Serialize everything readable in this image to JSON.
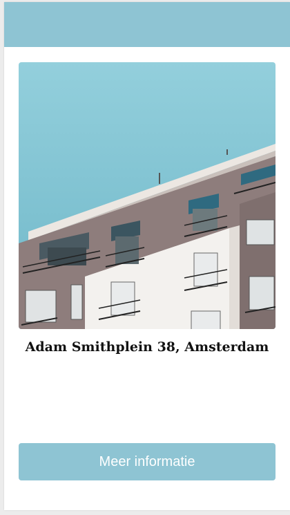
{
  "listing": {
    "address": "Adam Smithplein 38, Amsterdam",
    "photo_subject": "apartment-building",
    "more_info_label": "Meer informatie"
  },
  "colors": {
    "header": "#8ec4d3",
    "button": "#8ec4d3",
    "sky": "#8fcbd9"
  }
}
